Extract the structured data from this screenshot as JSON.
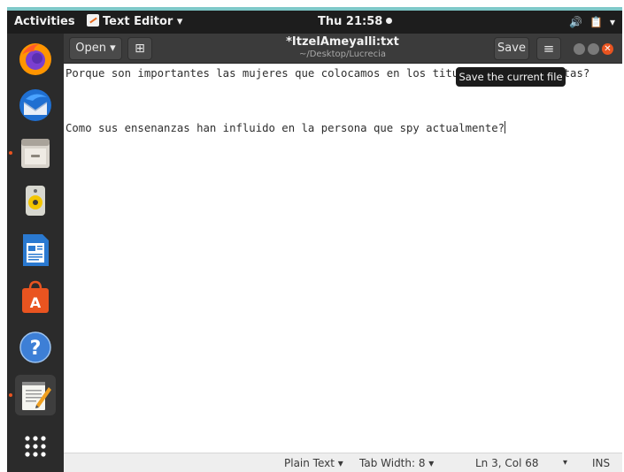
{
  "topbar": {
    "activities": "Activities",
    "app_name": "Text Editor",
    "app_arrow": "▾",
    "clock": "Thu 21:58",
    "tray_volume": "🔊",
    "tray_clipboard": "📋",
    "tray_arrow": "▾"
  },
  "dock": {
    "items": [
      "firefox-icon",
      "thunderbird-icon",
      "files-icon",
      "rhythmbox-icon",
      "writer-icon",
      "software-icon",
      "help-icon",
      "text-editor-icon",
      "apps-grid-icon"
    ]
  },
  "headerbar": {
    "open_label": "Open",
    "open_arrow": "▾",
    "pin_glyph": "⊞",
    "title": "*ItzelAmeyalli:txt",
    "subtitle": "~/Desktop/Lucrecia",
    "save_label": "Save",
    "menu_glyph": "≡",
    "close_glyph": "✕"
  },
  "editor": {
    "line1": "Porque son importantes las mujeres que colocamos en los titulos de las carpetas?",
    "line3": "Como sus ensenanzas han influido en la persona que spy actualmente?"
  },
  "tooltip": "Save the current file",
  "statusbar": {
    "language": "Plain Text ▾",
    "tab_width": "Tab Width: 8 ▾",
    "position": "Ln 3, Col 68",
    "position_arrow": "▾",
    "mode": "INS"
  },
  "colors": {
    "accent": "#e95420",
    "topbar": "#1d1d1d",
    "dock": "#2b2b2b",
    "headerbar": "#3b3b3b"
  }
}
